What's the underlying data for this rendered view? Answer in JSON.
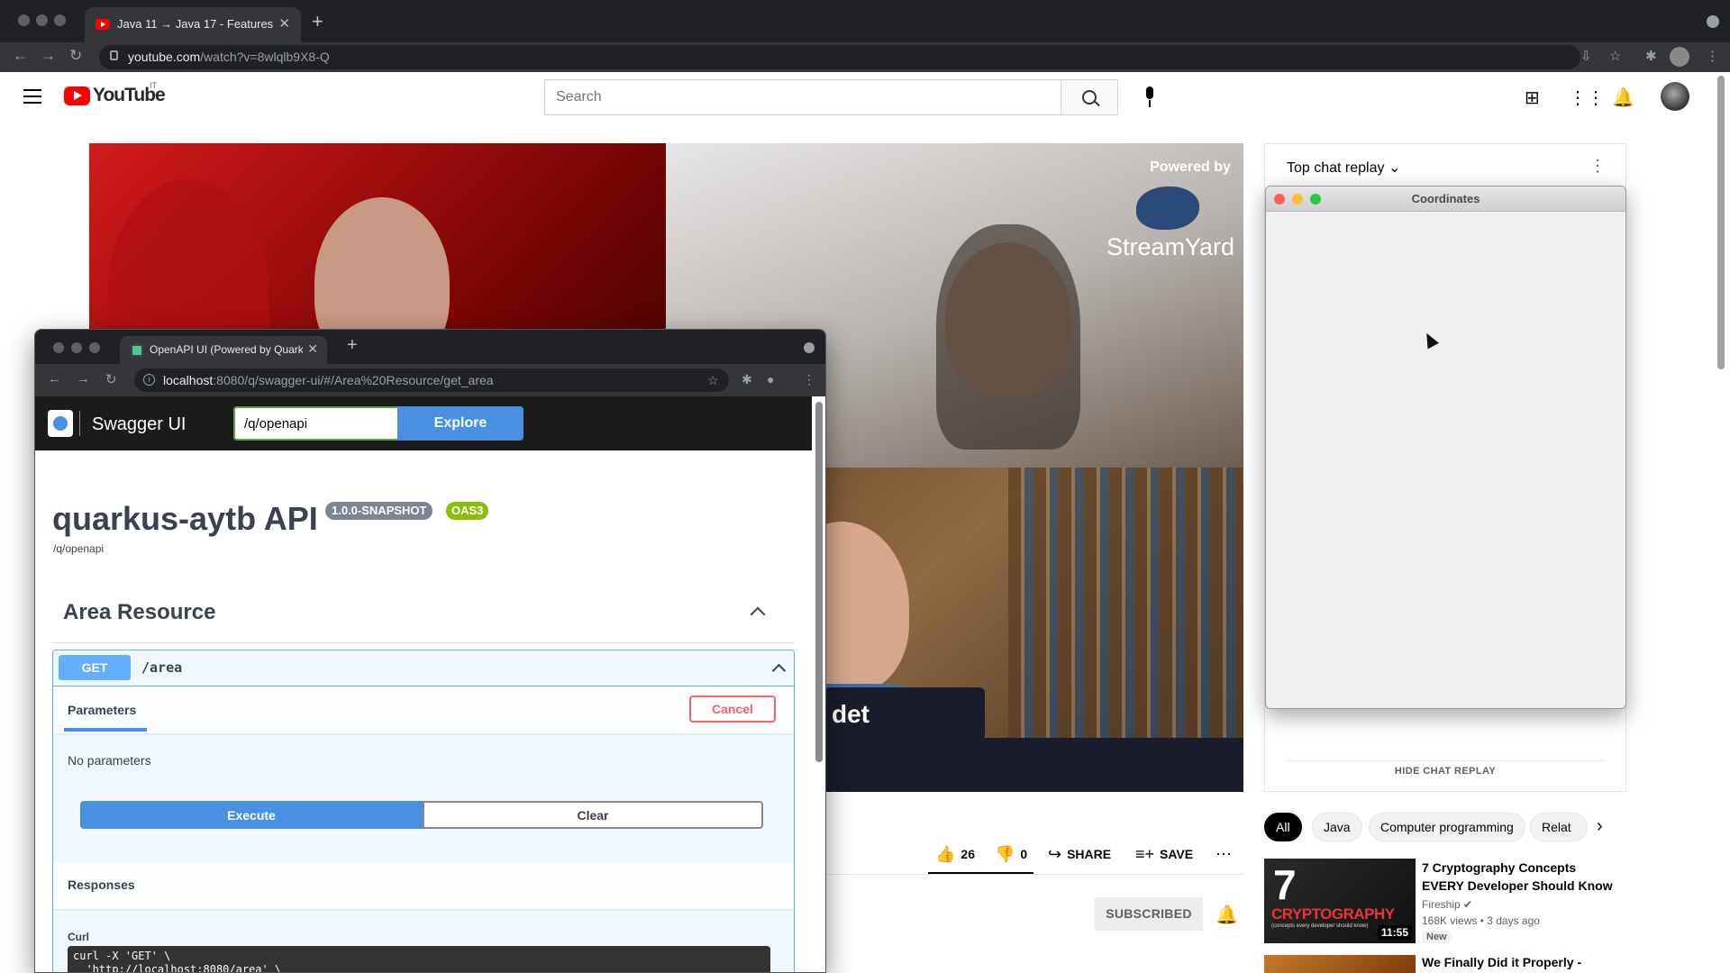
{
  "browser": {
    "tab_title": "Java 11 → Java 17 - Features &",
    "url_host": "youtube.com",
    "url_path": "/watch?v=8wlqlb9X8-Q"
  },
  "youtube": {
    "logo_text": "YouTube",
    "country_code": "IT",
    "search_placeholder": "Search",
    "video": {
      "powered_by": "Powered by",
      "streamyard": "StreamYard",
      "lower_third": "det"
    },
    "actions": {
      "likes": "26",
      "dislikes": "0",
      "share": "SHARE",
      "save": "SAVE"
    },
    "subscribed_label": "SUBSCRIBED",
    "chat": {
      "title": "Top chat replay",
      "hide_label": "HIDE CHAT REPLAY"
    },
    "chips": [
      "All",
      "Java",
      "Computer programming",
      "Relat"
    ],
    "recommendations": [
      {
        "title": "7 Cryptography Concepts EVERY Developer Should Know",
        "channel": "Fireship",
        "meta": "168K views • 3 days ago",
        "badge": "New",
        "duration": "11:55",
        "thumb_big": "7",
        "thumb_word": "CRYPTOGRAPHY",
        "thumb_sub": "(concepts every developer should know)"
      },
      {
        "title": "We Finally Did it Properly -"
      }
    ]
  },
  "coordinates_window": {
    "title": "Coordinates"
  },
  "swagger_window": {
    "tab_title": "OpenAPI UI (Powered by Quark",
    "url_host": "localhost",
    "url_rest": ":8080/q/swagger-ui/#/Area%20Resource/get_area",
    "brand": "Swagger UI",
    "spec_url": "/q/openapi",
    "explore_label": "Explore",
    "api_title": "quarkus-aytb API",
    "version_badge": "1.0.0-SNAPSHOT",
    "oas_badge": "OAS3",
    "api_url": "/q/openapi",
    "tag_title": "Area Resource",
    "operation": {
      "method": "GET",
      "path": "/area",
      "parameters_tab": "Parameters",
      "cancel_label": "Cancel",
      "no_parameters": "No parameters",
      "execute_label": "Execute",
      "clear_label": "Clear",
      "responses_title": "Responses",
      "curl_label": "Curl",
      "curl_text": "curl -X 'GET' \\\n  'http://localhost:8080/area' \\"
    }
  }
}
